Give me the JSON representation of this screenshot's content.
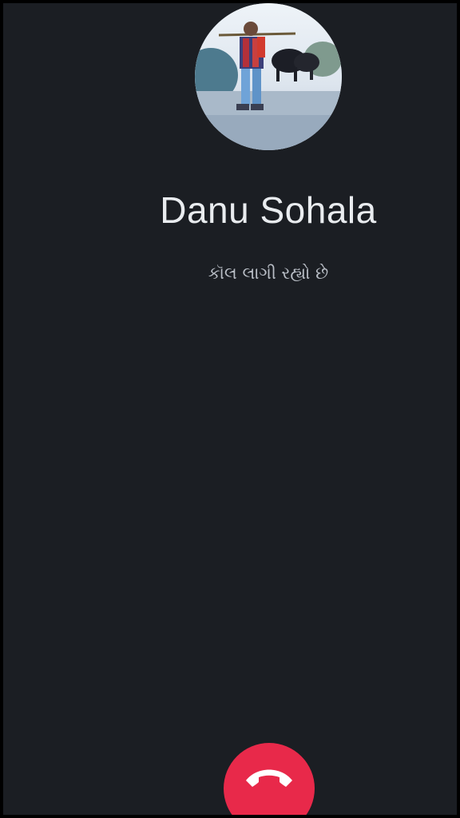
{
  "caller": {
    "name": "Danu Sohala",
    "status": "કૉલ લાગી રહ્યો છે"
  },
  "icons": {
    "avatar": "contact-photo",
    "end_call": "phone-hangup-icon"
  },
  "colors": {
    "background": "#1b1e23",
    "end_call": "#e8294a",
    "name_text": "#e9ecef",
    "status_text": "#b9bec6"
  }
}
